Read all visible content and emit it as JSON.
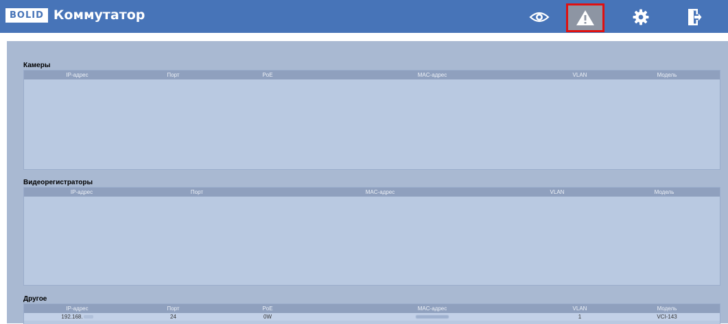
{
  "header": {
    "logo_text": "BOLID",
    "title": "Коммутатор",
    "icons": [
      "eye-icon",
      "warning-icon",
      "gear-icon",
      "exit-icon"
    ]
  },
  "colors": {
    "topbar": "#4774b8",
    "content_bg": "#a9b9d2",
    "table_bg": "#b9c9e1",
    "header_row": "#8fa0be",
    "active_highlight": "#e01010"
  },
  "cameras": {
    "label": "Камеры",
    "columns": [
      "IP-адрес",
      "Порт",
      "PoE",
      "MAC-адрес",
      "VLAN",
      "Модель"
    ],
    "rows": []
  },
  "recorders": {
    "label": "Видеорегистраторы",
    "columns": [
      "IP-адрес",
      "Порт",
      "MAC-адрес",
      "VLAN",
      "Модель"
    ],
    "rows": []
  },
  "other": {
    "label": "Другое",
    "columns": [
      "IP-адрес",
      "Порт",
      "PoE",
      "MAC-адрес",
      "VLAN",
      "Модель"
    ],
    "rows": [
      {
        "ip": "192.168.",
        "port": "24",
        "poe": "0W",
        "mac": "",
        "vlan": "1",
        "model": "VCI-143"
      }
    ]
  }
}
